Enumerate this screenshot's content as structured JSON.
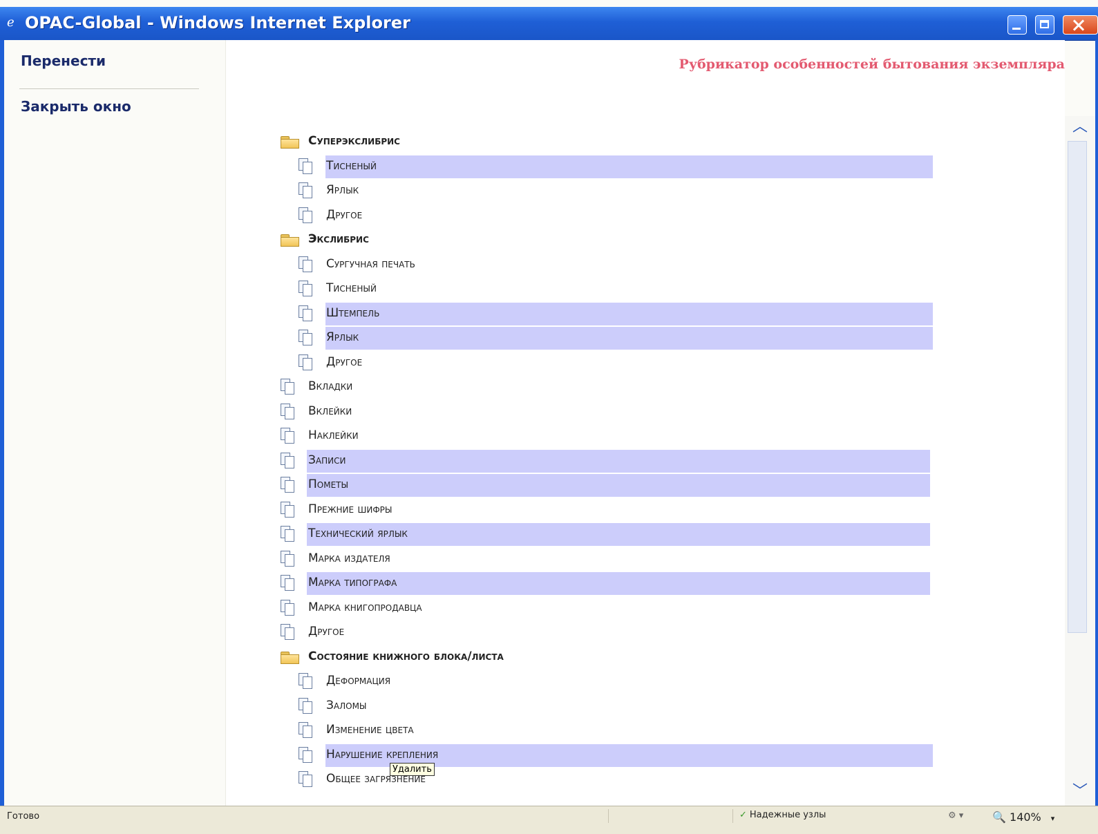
{
  "window": {
    "title": "OPAC-Global - Windows Internet Explorer",
    "icon": "ie-icon"
  },
  "sidebar": {
    "move_link": "Перенести",
    "close_link": "Закрыть окно"
  },
  "main": {
    "heading": "Рубрикатор особенностей бытования экземпляра"
  },
  "tree": [
    {
      "label": "Суперэкслибрис",
      "level": 0,
      "type": "folder",
      "highlighted": false
    },
    {
      "label": "Тисненый",
      "level": 1,
      "type": "item",
      "highlighted": true
    },
    {
      "label": "Ярлык",
      "level": 1,
      "type": "item",
      "highlighted": false
    },
    {
      "label": "Другое",
      "level": 1,
      "type": "item",
      "highlighted": false
    },
    {
      "label": "Экслибрис",
      "level": 0,
      "type": "folder",
      "highlighted": false
    },
    {
      "label": "Сургучная печать",
      "level": 1,
      "type": "item",
      "highlighted": false
    },
    {
      "label": "Тисненый",
      "level": 1,
      "type": "item",
      "highlighted": false
    },
    {
      "label": "Штемпель",
      "level": 1,
      "type": "item",
      "highlighted": true
    },
    {
      "label": "Ярлык",
      "level": 1,
      "type": "item",
      "highlighted": true
    },
    {
      "label": "Другое",
      "level": 1,
      "type": "item",
      "highlighted": false
    },
    {
      "label": "Вкладки",
      "level": 0,
      "type": "item",
      "highlighted": false
    },
    {
      "label": "Вклейки",
      "level": 0,
      "type": "item",
      "highlighted": false
    },
    {
      "label": "Наклейки",
      "level": 0,
      "type": "item",
      "highlighted": false
    },
    {
      "label": "Записи",
      "level": 0,
      "type": "item",
      "highlighted": true
    },
    {
      "label": "Пометы",
      "level": 0,
      "type": "item",
      "highlighted": true
    },
    {
      "label": "Прежние шифры",
      "level": 0,
      "type": "item",
      "highlighted": false
    },
    {
      "label": "Технический ярлык",
      "level": 0,
      "type": "item",
      "highlighted": true
    },
    {
      "label": "Марка издателя",
      "level": 0,
      "type": "item",
      "highlighted": false
    },
    {
      "label": "Марка типографа",
      "level": 0,
      "type": "item",
      "highlighted": true
    },
    {
      "label": "Марка книгопродавца",
      "level": 0,
      "type": "item",
      "highlighted": false
    },
    {
      "label": "Другое",
      "level": 0,
      "type": "item",
      "highlighted": false
    },
    {
      "label": "Состояние книжного блока/листа",
      "level": 0,
      "type": "folder",
      "highlighted": false
    },
    {
      "label": "Деформация",
      "level": 1,
      "type": "item",
      "highlighted": false
    },
    {
      "label": "Заломы",
      "level": 1,
      "type": "item",
      "highlighted": false
    },
    {
      "label": "Изменение цвета",
      "level": 1,
      "type": "item",
      "highlighted": false
    },
    {
      "label": "Нарушение крепления",
      "level": 1,
      "type": "item",
      "highlighted": true
    },
    {
      "label": "Общее загрязнение",
      "level": 1,
      "type": "item",
      "highlighted": false
    }
  ],
  "tooltip": "Удалить",
  "statusbar": {
    "status": "Готово",
    "zone": "Надежные узлы",
    "zoom": "140%"
  },
  "colors": {
    "highlight": "#cccdfb",
    "heading": "#e35a70",
    "titlebar": "#1f5fd6",
    "link": "#1a2a6a"
  }
}
